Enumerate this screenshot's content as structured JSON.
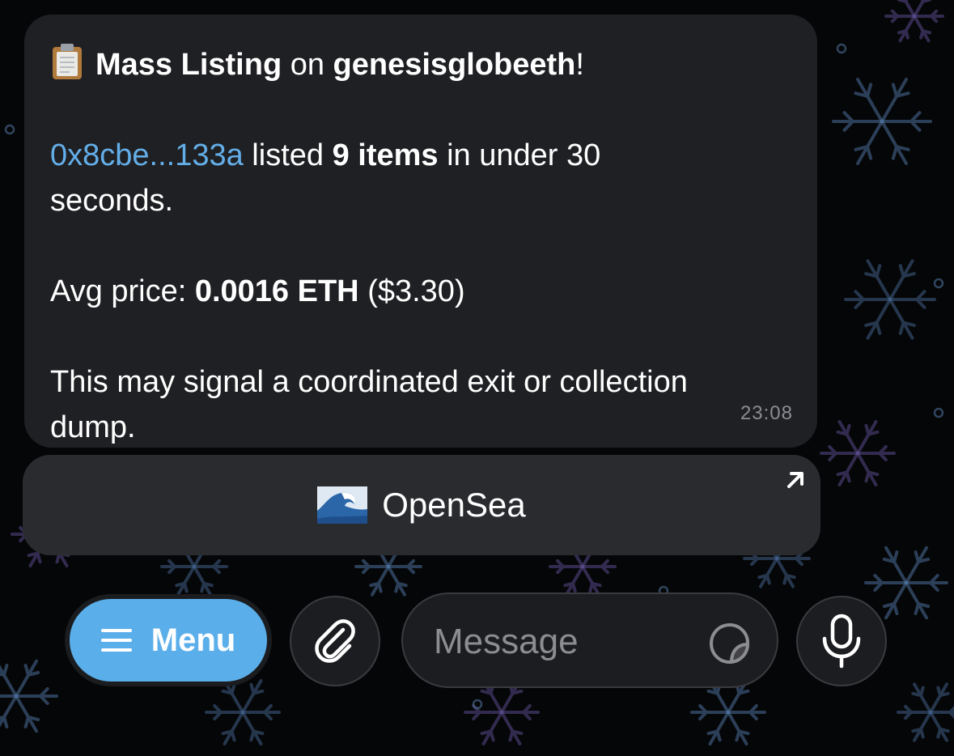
{
  "message": {
    "title_part1": "Mass Listing",
    "title_part2": " on ",
    "title_part3": "genesisglobeeth",
    "title_part4": "!",
    "address": "0x8cbe...133a",
    "listed_text1": " listed ",
    "items_count": "9 items",
    "listed_text2": " in under 30",
    "listed_text3": "seconds.",
    "avg_label": "Avg price: ",
    "avg_price": "0.0016 ETH",
    "avg_usd": " ($3.30)",
    "warning_line1": "This may signal a coordinated exit or collection",
    "warning_line2": "dump.",
    "time": "23:08"
  },
  "link_button": {
    "label": "OpenSea",
    "icon": "wave-icon"
  },
  "composer": {
    "menu_label": "Menu",
    "placeholder": "Message",
    "attach_icon": "paperclip-icon",
    "sticker_icon": "sticker-icon",
    "mic_icon": "microphone-icon"
  },
  "colors": {
    "background": "#050607",
    "bubble": "#1f2023",
    "link": "#63aee9",
    "menu_button": "#5aaeea"
  }
}
